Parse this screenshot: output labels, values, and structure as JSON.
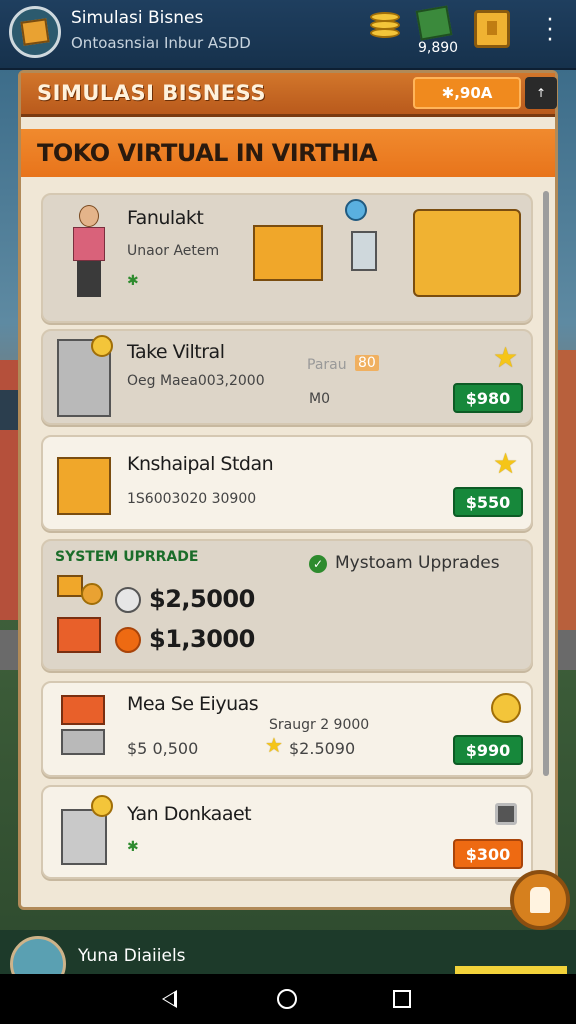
{
  "app": {
    "title": "Simulasi Bisnes",
    "subtitle": "Ontoasnsiaı Inbur ASDD",
    "money": "9,890"
  },
  "panel": {
    "title": "SIMULASI BISNESS",
    "header_pill": "✱,90A",
    "menu_glyph": "↑"
  },
  "store": {
    "title": "TOKO VIRTUAL IN VIRTHIA"
  },
  "items": [
    {
      "name": "Fanulakt",
      "sub": "Unaor Aetem",
      "sub_icon": "✱"
    },
    {
      "name": "Take Viltral",
      "sub": "Oeg Maea003,2000",
      "extra": "Parau",
      "extra_badge": "80",
      "count": "M0",
      "price": "$980"
    },
    {
      "name": "Knshaipal Stdan",
      "sub": "1S6003020 30900",
      "price": "$550"
    },
    {
      "name": "Mea Se Eiyuas",
      "sub": "$5 0,500",
      "extra": "Sraugr 2 9000",
      "star_value": "$2.5090",
      "price": "$990"
    },
    {
      "name": "Yan Donkaaet",
      "sub": "✱",
      "price": "$300"
    }
  ],
  "upgrade": {
    "label": "SYSTEM UPRRADE",
    "note": "Mystoam Upprades",
    "price_a": "$2,5000",
    "price_b": "$1,3000"
  },
  "footer": {
    "name": "Yuna Diaiiels"
  },
  "colors": {
    "accent_orange": "#e8741b",
    "buy_green": "#17883b",
    "header_blue": "#1f3f5f"
  },
  "icons": [
    "crate-icon",
    "coins-icon",
    "cash-icon",
    "more-icon",
    "star-icon",
    "coin-icon",
    "check-icon",
    "chat-icon"
  ]
}
